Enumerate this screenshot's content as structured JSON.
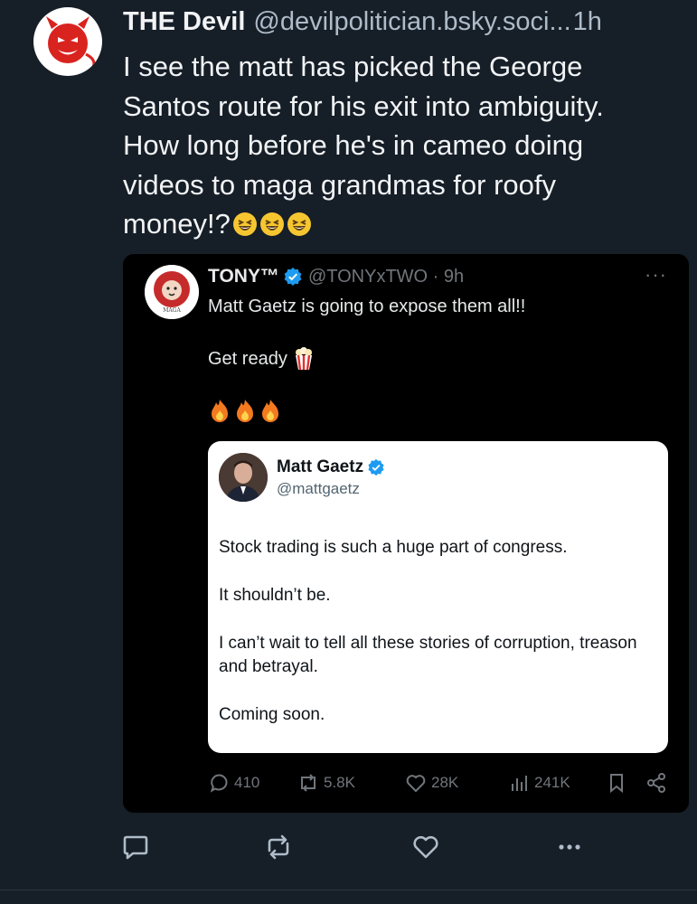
{
  "post": {
    "display_name": "THE Devil",
    "handle": "@devilpolitician.bsky.soci...",
    "time": "1h",
    "text_lines": [
      "I see the matt has picked the George",
      "Santos route for his exit into ambiguity.",
      "How long before he's in cameo doing",
      "videos to maga grandmas for roofy",
      "money!?"
    ]
  },
  "embed": {
    "display_name": "TONY™",
    "handle": "@TONYxTWO · 9h",
    "text_1": "Matt Gaetz is going to expose them all!!",
    "text_2": "Get ready",
    "avatar_caption": "MAGA",
    "quote": {
      "display_name": "Matt Gaetz",
      "handle": "@mattgaetz",
      "paragraphs": [
        "Stock trading is such a huge part of congress.",
        "It shouldn’t be.",
        "I can’t wait to tell all these stories of corruption, treason and betrayal.",
        "Coming soon."
      ]
    },
    "stats": {
      "replies": "410",
      "reposts": "5.8K",
      "likes": "28K",
      "views": "241K"
    }
  },
  "icons": {
    "reply": "speech-bubble-icon",
    "repost": "repost-arrows-icon",
    "like": "heart-icon",
    "more": "ellipsis-icon",
    "bookmark": "bookmark-icon",
    "share": "share-icon"
  },
  "colors": {
    "background": "#161e27",
    "text": "#f1f3f5",
    "muted": "#aebbc9",
    "verified": "#1d9bf0"
  }
}
